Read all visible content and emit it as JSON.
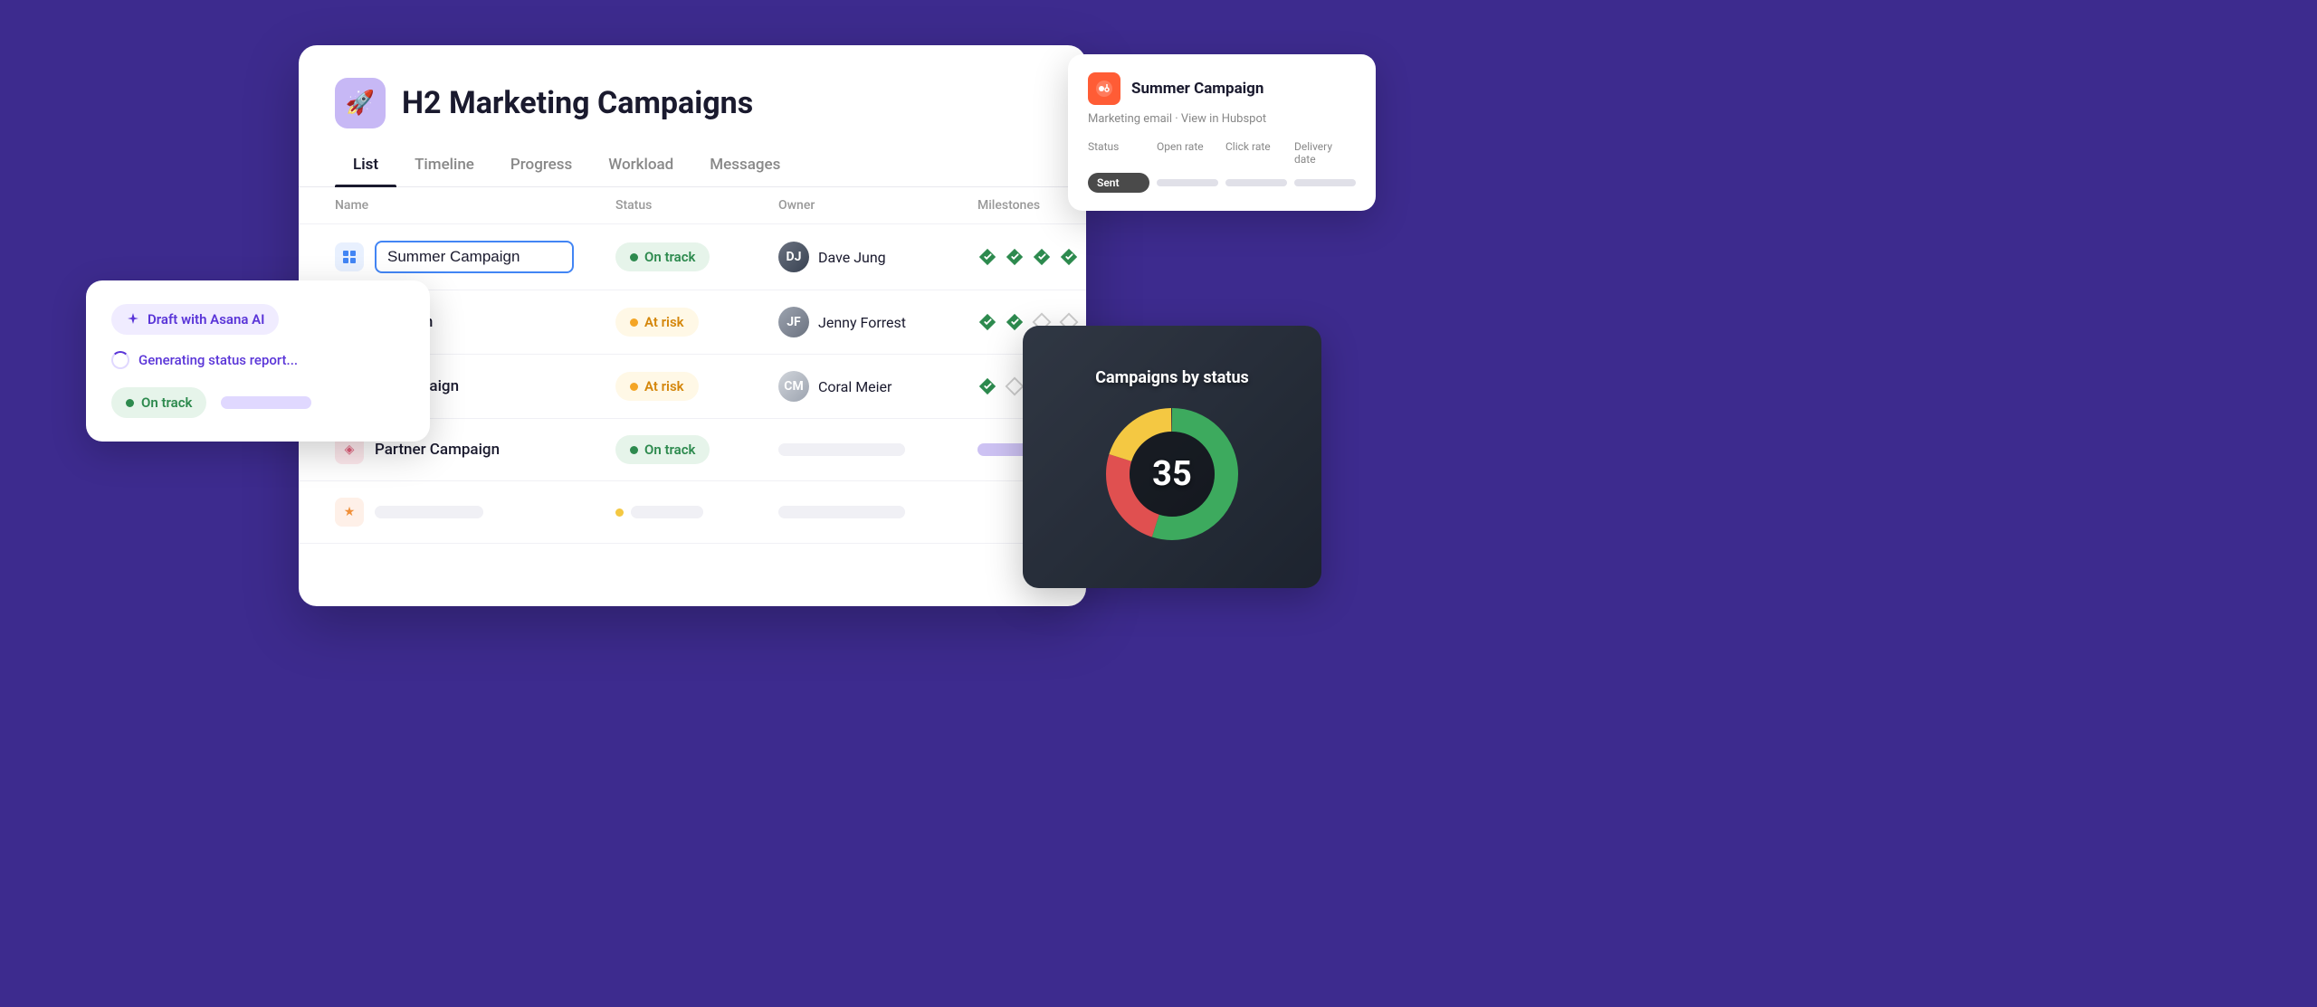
{
  "background_color": "#3d2b8e",
  "main_card": {
    "project_icon": "🚀",
    "project_title": "H2 Marketing Campaigns",
    "tabs": [
      {
        "label": "List",
        "active": true
      },
      {
        "label": "Timeline",
        "active": false
      },
      {
        "label": "Progress",
        "active": false
      },
      {
        "label": "Workload",
        "active": false
      },
      {
        "label": "Messages",
        "active": false
      }
    ],
    "table": {
      "columns": [
        "Name",
        "Status",
        "Owner",
        "Milestones"
      ],
      "rows": [
        {
          "id": "summer",
          "icon_type": "blue",
          "icon_symbol": "▦",
          "name": "Summer Campaign",
          "name_editing": true,
          "status": "On track",
          "status_type": "on-track",
          "owner_name": "Dave Jung",
          "owner_initials": "DJ",
          "milestones": [
            "filled",
            "filled",
            "filled",
            "filled",
            "empty"
          ]
        },
        {
          "id": "fall",
          "icon_type": "none",
          "name": "Fall Campaign",
          "name_editing": false,
          "status": "At risk",
          "status_type": "at-risk",
          "owner_name": "Jenny Forrest",
          "owner_initials": "JF",
          "milestones": [
            "filled",
            "filled",
            "empty",
            "empty"
          ]
        },
        {
          "id": "launch",
          "icon_type": "none",
          "name": "Launch Campaign",
          "name_editing": false,
          "status": "At risk",
          "status_type": "at-risk",
          "owner_name": "Coral Meier",
          "owner_initials": "CM",
          "milestones": [
            "filled",
            "empty"
          ]
        },
        {
          "id": "partner",
          "icon_type": "pink",
          "icon_symbol": "◈",
          "name": "Partner Campaign",
          "name_editing": false,
          "status": "On track",
          "status_type": "on-track",
          "owner_placeholder": true,
          "milestones_placeholder": true
        },
        {
          "id": "row5",
          "icon_type": "star",
          "icon_symbol": "★",
          "name_placeholder": true,
          "status_placeholder": true,
          "owner_placeholder2": true
        }
      ]
    }
  },
  "ai_card": {
    "draft_button_label": "Draft with Asana AI",
    "generating_label": "Generating status report...",
    "status_label": "On track"
  },
  "hubspot_card": {
    "title": "Summer Campaign",
    "subtitle": "Marketing email · View in Hubspot",
    "columns": [
      "Status",
      "Open rate",
      "Click rate",
      "Delivery date"
    ],
    "status_value": "Sent"
  },
  "chart_card": {
    "title": "Campaigns by status",
    "center_number": "35",
    "segments": [
      {
        "color": "#3daa5e",
        "percentage": 55
      },
      {
        "color": "#e05050",
        "percentage": 25
      },
      {
        "color": "#f4c842",
        "percentage": 20
      }
    ]
  }
}
